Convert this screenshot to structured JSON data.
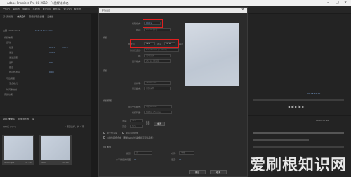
{
  "window": {
    "title": "Adobe Premiere Pro CC 2019 - F:\\视频\\未命名"
  },
  "menu": [
    "文件(F)",
    "编辑(E)",
    "剪辑(C)",
    "序列(S)",
    "标记(M)",
    "图形(G)",
    "窗口(W)",
    "帮助(H)"
  ],
  "source_panel": {
    "tabs": [
      "源:(无剪辑)",
      "效果控件",
      "音频剪辑混合器",
      "元数据"
    ],
    "clip": "主要 * hahu.mp4",
    "sequence": "hahu * hahu.mp4",
    "rows": [
      "视频效果",
      "运动",
      "位置",
      "缩放",
      "缩放宽度",
      "旋转",
      "锚点",
      "防闪烁滤镜",
      "不透明度",
      "混合模式",
      "时间重映射",
      "音频效果"
    ],
    "values": [
      "960.0",
      "540.0",
      "100.0",
      "0.0",
      "0.00"
    ]
  },
  "project_panel": {
    "tabs": [
      "项目: 未命名",
      "媒体浏览器",
      "库"
    ],
    "project_file": "未命名.prproj",
    "count": "1 项已选择，共 2 项",
    "items": [
      {
        "name": "hahu.mp4",
        "duration": "37:10"
      },
      {
        "name": "hahu",
        "duration": "37:10"
      }
    ]
  },
  "dialog": {
    "title": "序列设置",
    "close": "×",
    "edit_mode_label": "编辑模式:",
    "edit_mode_value": "自定义",
    "timebase_label": "时基:",
    "timebase_value": "25.00 帧/秒",
    "video_section": "视频",
    "frame_size_label": "帧大小:",
    "frame_width": "720",
    "horizontal_label": "水平",
    "frame_height": "576",
    "aspect_label": "垂直",
    "aspect_value": "4:3",
    "pixel_aspect_label": "像素长宽比:",
    "pixel_aspect_value": "D1/DV PAL (1.0940)",
    "fields_label": "场:",
    "fields_value": "低场优先",
    "display_format_label": "显示格式:",
    "display_format_value": "25 fps 时间码",
    "audio_section": "音频",
    "sample_rate_label": "采样率:",
    "sample_rate_value": "48000 Hz",
    "audio_display_label": "显示格式:",
    "audio_display_value": "音频采样",
    "preview_section": "视频预览",
    "preview_format_label": "预览文件格式:",
    "preview_format_value": "I 帧 MPEG",
    "codec_label": "编解码器:",
    "codec_value": "MPEG I-Frame",
    "width_label": "宽度:",
    "width_value": "720",
    "height_label": "高度:",
    "height_value": "576",
    "reset_button": "重置",
    "max_depth_label": "最大位深度",
    "max_quality_label": "最高渲染质量",
    "linear_label": "以线性颜色合成（要求 GPU 加速或最高渲染品质）",
    "vr_section": "VR 属性",
    "projection_label": "投影:",
    "projection_value": "无",
    "layout_label": "布局:",
    "layout_value": "单像",
    "h_view_label": "水平捕捉的视图:",
    "h_view_value": "0°",
    "v_view_label": "垂直:",
    "v_view_value": "0°",
    "ok_button": "确定",
    "cancel_button": "取消"
  },
  "program_panel": {
    "timecode": "00:05:37:10",
    "time_start": "00:05:37:10"
  },
  "watermark": "爱刷根知识网",
  "colors": {
    "accent": "#7aa2d6",
    "highlight": "#e02020"
  }
}
